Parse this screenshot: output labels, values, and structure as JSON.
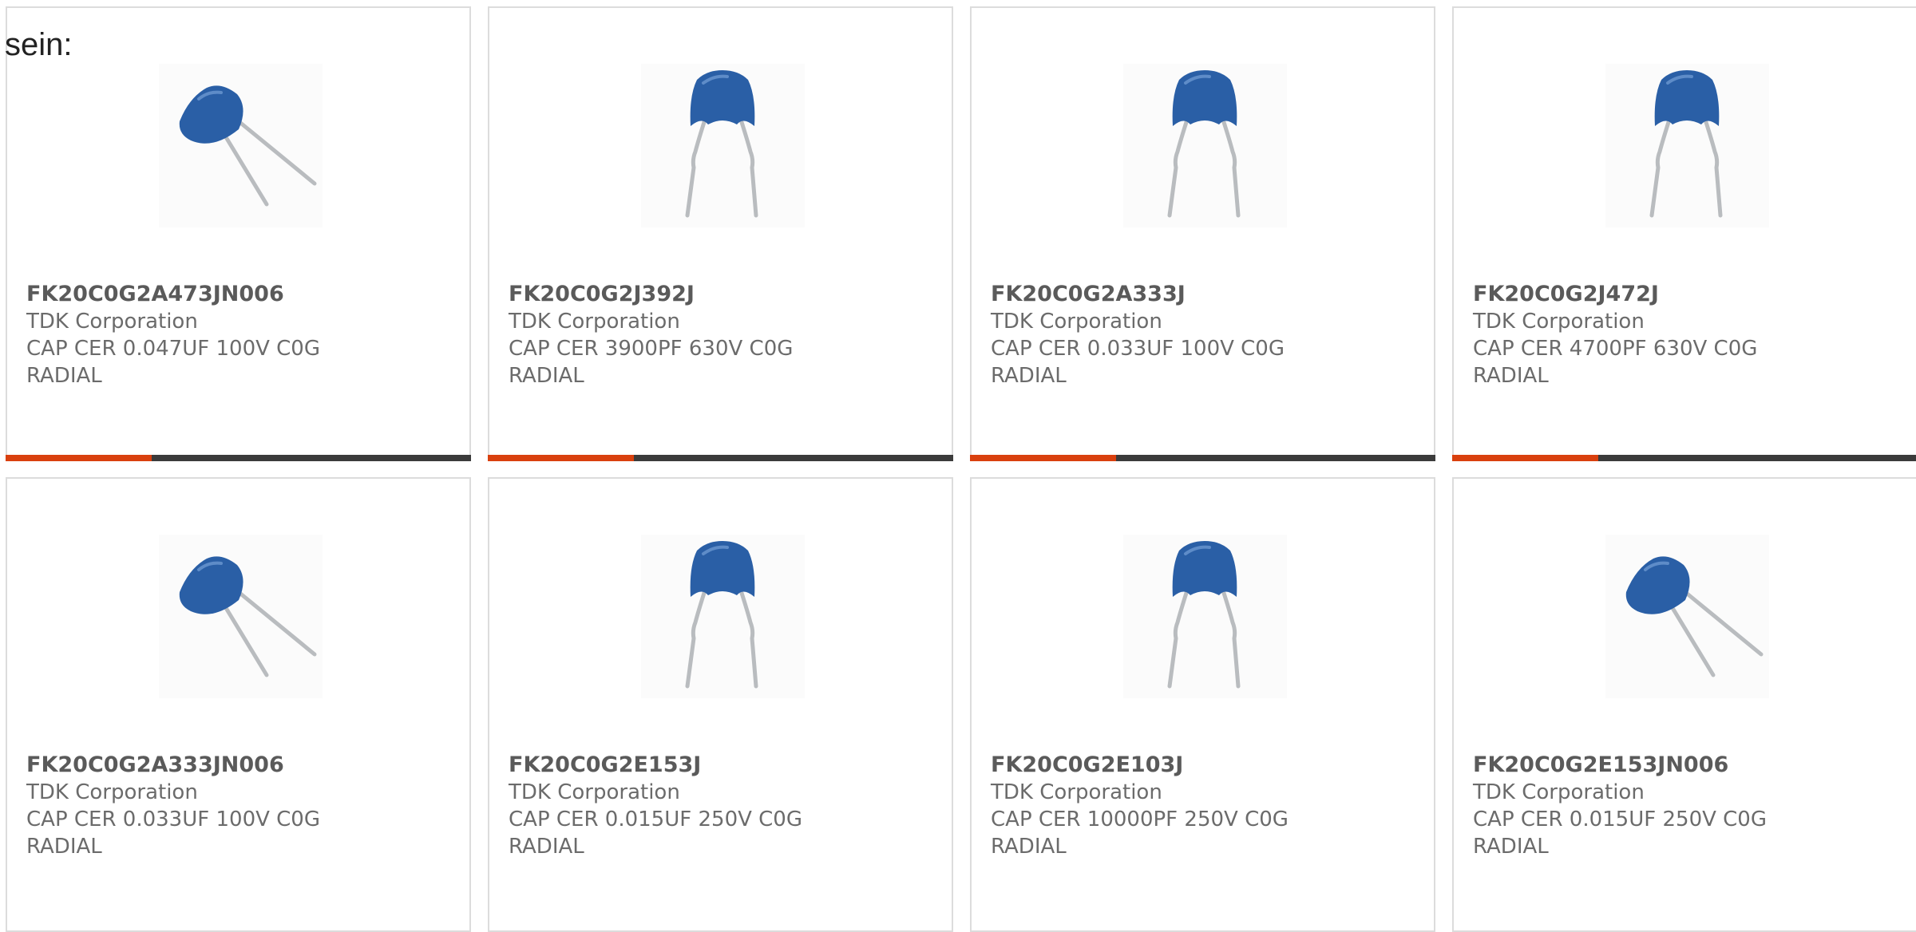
{
  "intro_text": "sein:",
  "colors": {
    "accent_red": "#d9400e",
    "accent_dark": "#3b3b3b",
    "capacitor_blue": "#2a5fa6",
    "text_gray": "#6b6b6b"
  },
  "products": [
    {
      "part_number": "FK20C0G2A473JN006",
      "manufacturer": "TDK Corporation",
      "description": "CAP CER 0.047UF 100V C0G",
      "package": "RADIAL",
      "image_icon": "capacitor-tilted-icon"
    },
    {
      "part_number": "FK20C0G2J392J",
      "manufacturer": "TDK Corporation",
      "description": "CAP CER 3900PF 630V C0G",
      "package": "RADIAL",
      "image_icon": "capacitor-upright-icon"
    },
    {
      "part_number": "FK20C0G2A333J",
      "manufacturer": "TDK Corporation",
      "description": "CAP CER 0.033UF 100V C0G",
      "package": "RADIAL",
      "image_icon": "capacitor-upright-icon"
    },
    {
      "part_number": "FK20C0G2J472J",
      "manufacturer": "TDK Corporation",
      "description": "CAP CER 4700PF 630V C0G",
      "package": "RADIAL",
      "image_icon": "capacitor-upright-icon"
    },
    {
      "part_number": "FK20C0G2A333JN006",
      "manufacturer": "TDK Corporation",
      "description": "CAP CER 0.033UF 100V C0G",
      "package": "RADIAL",
      "image_icon": "capacitor-tilted-icon"
    },
    {
      "part_number": "FK20C0G2E153J",
      "manufacturer": "TDK Corporation",
      "description": "CAP CER 0.015UF 250V C0G",
      "package": "RADIAL",
      "image_icon": "capacitor-upright-icon"
    },
    {
      "part_number": "FK20C0G2E103J",
      "manufacturer": "TDK Corporation",
      "description": "CAP CER 10000PF 250V C0G",
      "package": "RADIAL",
      "image_icon": "capacitor-upright-icon"
    },
    {
      "part_number": "FK20C0G2E153JN006",
      "manufacturer": "TDK Corporation",
      "description": "CAP CER 0.015UF 250V C0G",
      "package": "RADIAL",
      "image_icon": "capacitor-tilted-icon"
    }
  ]
}
